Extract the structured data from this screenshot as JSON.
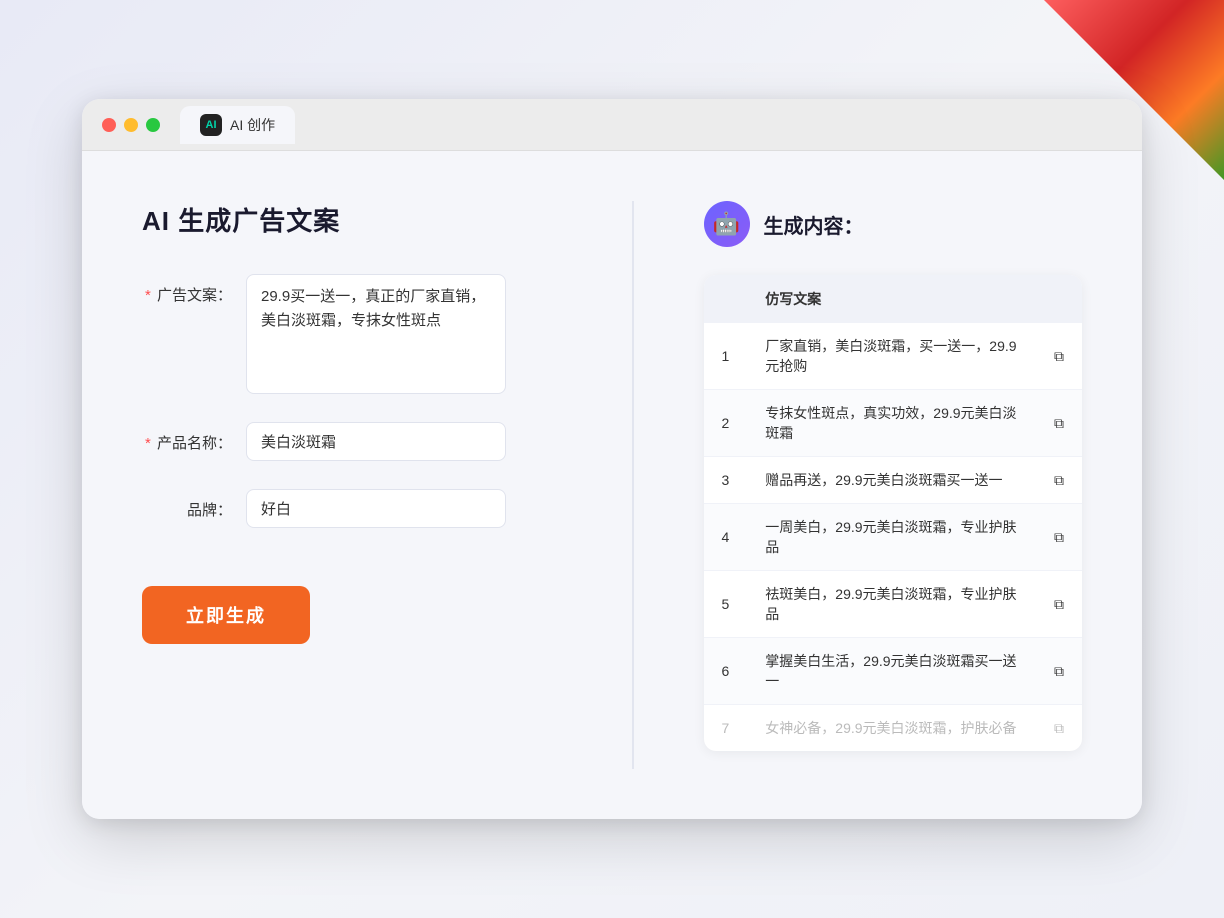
{
  "window": {
    "tab_icon_text": "AI",
    "tab_label": "AI 创作"
  },
  "left_panel": {
    "title": "AI 生成广告文案",
    "fields": [
      {
        "label": "广告文案：",
        "required": true,
        "type": "textarea",
        "value": "29.9买一送一，真正的厂家直销，美白淡斑霜，专抹女性斑点",
        "placeholder": ""
      },
      {
        "label": "产品名称：",
        "required": true,
        "type": "input",
        "value": "美白淡斑霜",
        "placeholder": ""
      },
      {
        "label": "品牌：",
        "required": false,
        "type": "input",
        "value": "好白",
        "placeholder": ""
      }
    ],
    "button_label": "立即生成"
  },
  "right_panel": {
    "title": "生成内容：",
    "column_header": "仿写文案",
    "results": [
      {
        "id": 1,
        "text": "厂家直销，美白淡斑霜，买一送一，29.9元抢购",
        "dimmed": false
      },
      {
        "id": 2,
        "text": "专抹女性斑点，真实功效，29.9元美白淡斑霜",
        "dimmed": false
      },
      {
        "id": 3,
        "text": "赠品再送，29.9元美白淡斑霜买一送一",
        "dimmed": false
      },
      {
        "id": 4,
        "text": "一周美白，29.9元美白淡斑霜，专业护肤品",
        "dimmed": false
      },
      {
        "id": 5,
        "text": "祛斑美白，29.9元美白淡斑霜，专业护肤品",
        "dimmed": false
      },
      {
        "id": 6,
        "text": "掌握美白生活，29.9元美白淡斑霜买一送一",
        "dimmed": false
      },
      {
        "id": 7,
        "text": "女神必备，29.9元美白淡斑霜，护肤必备",
        "dimmed": true
      }
    ]
  },
  "colors": {
    "accent_orange": "#f26522",
    "required_red": "#ff4d4f",
    "robot_purple": "#6c63ff"
  }
}
